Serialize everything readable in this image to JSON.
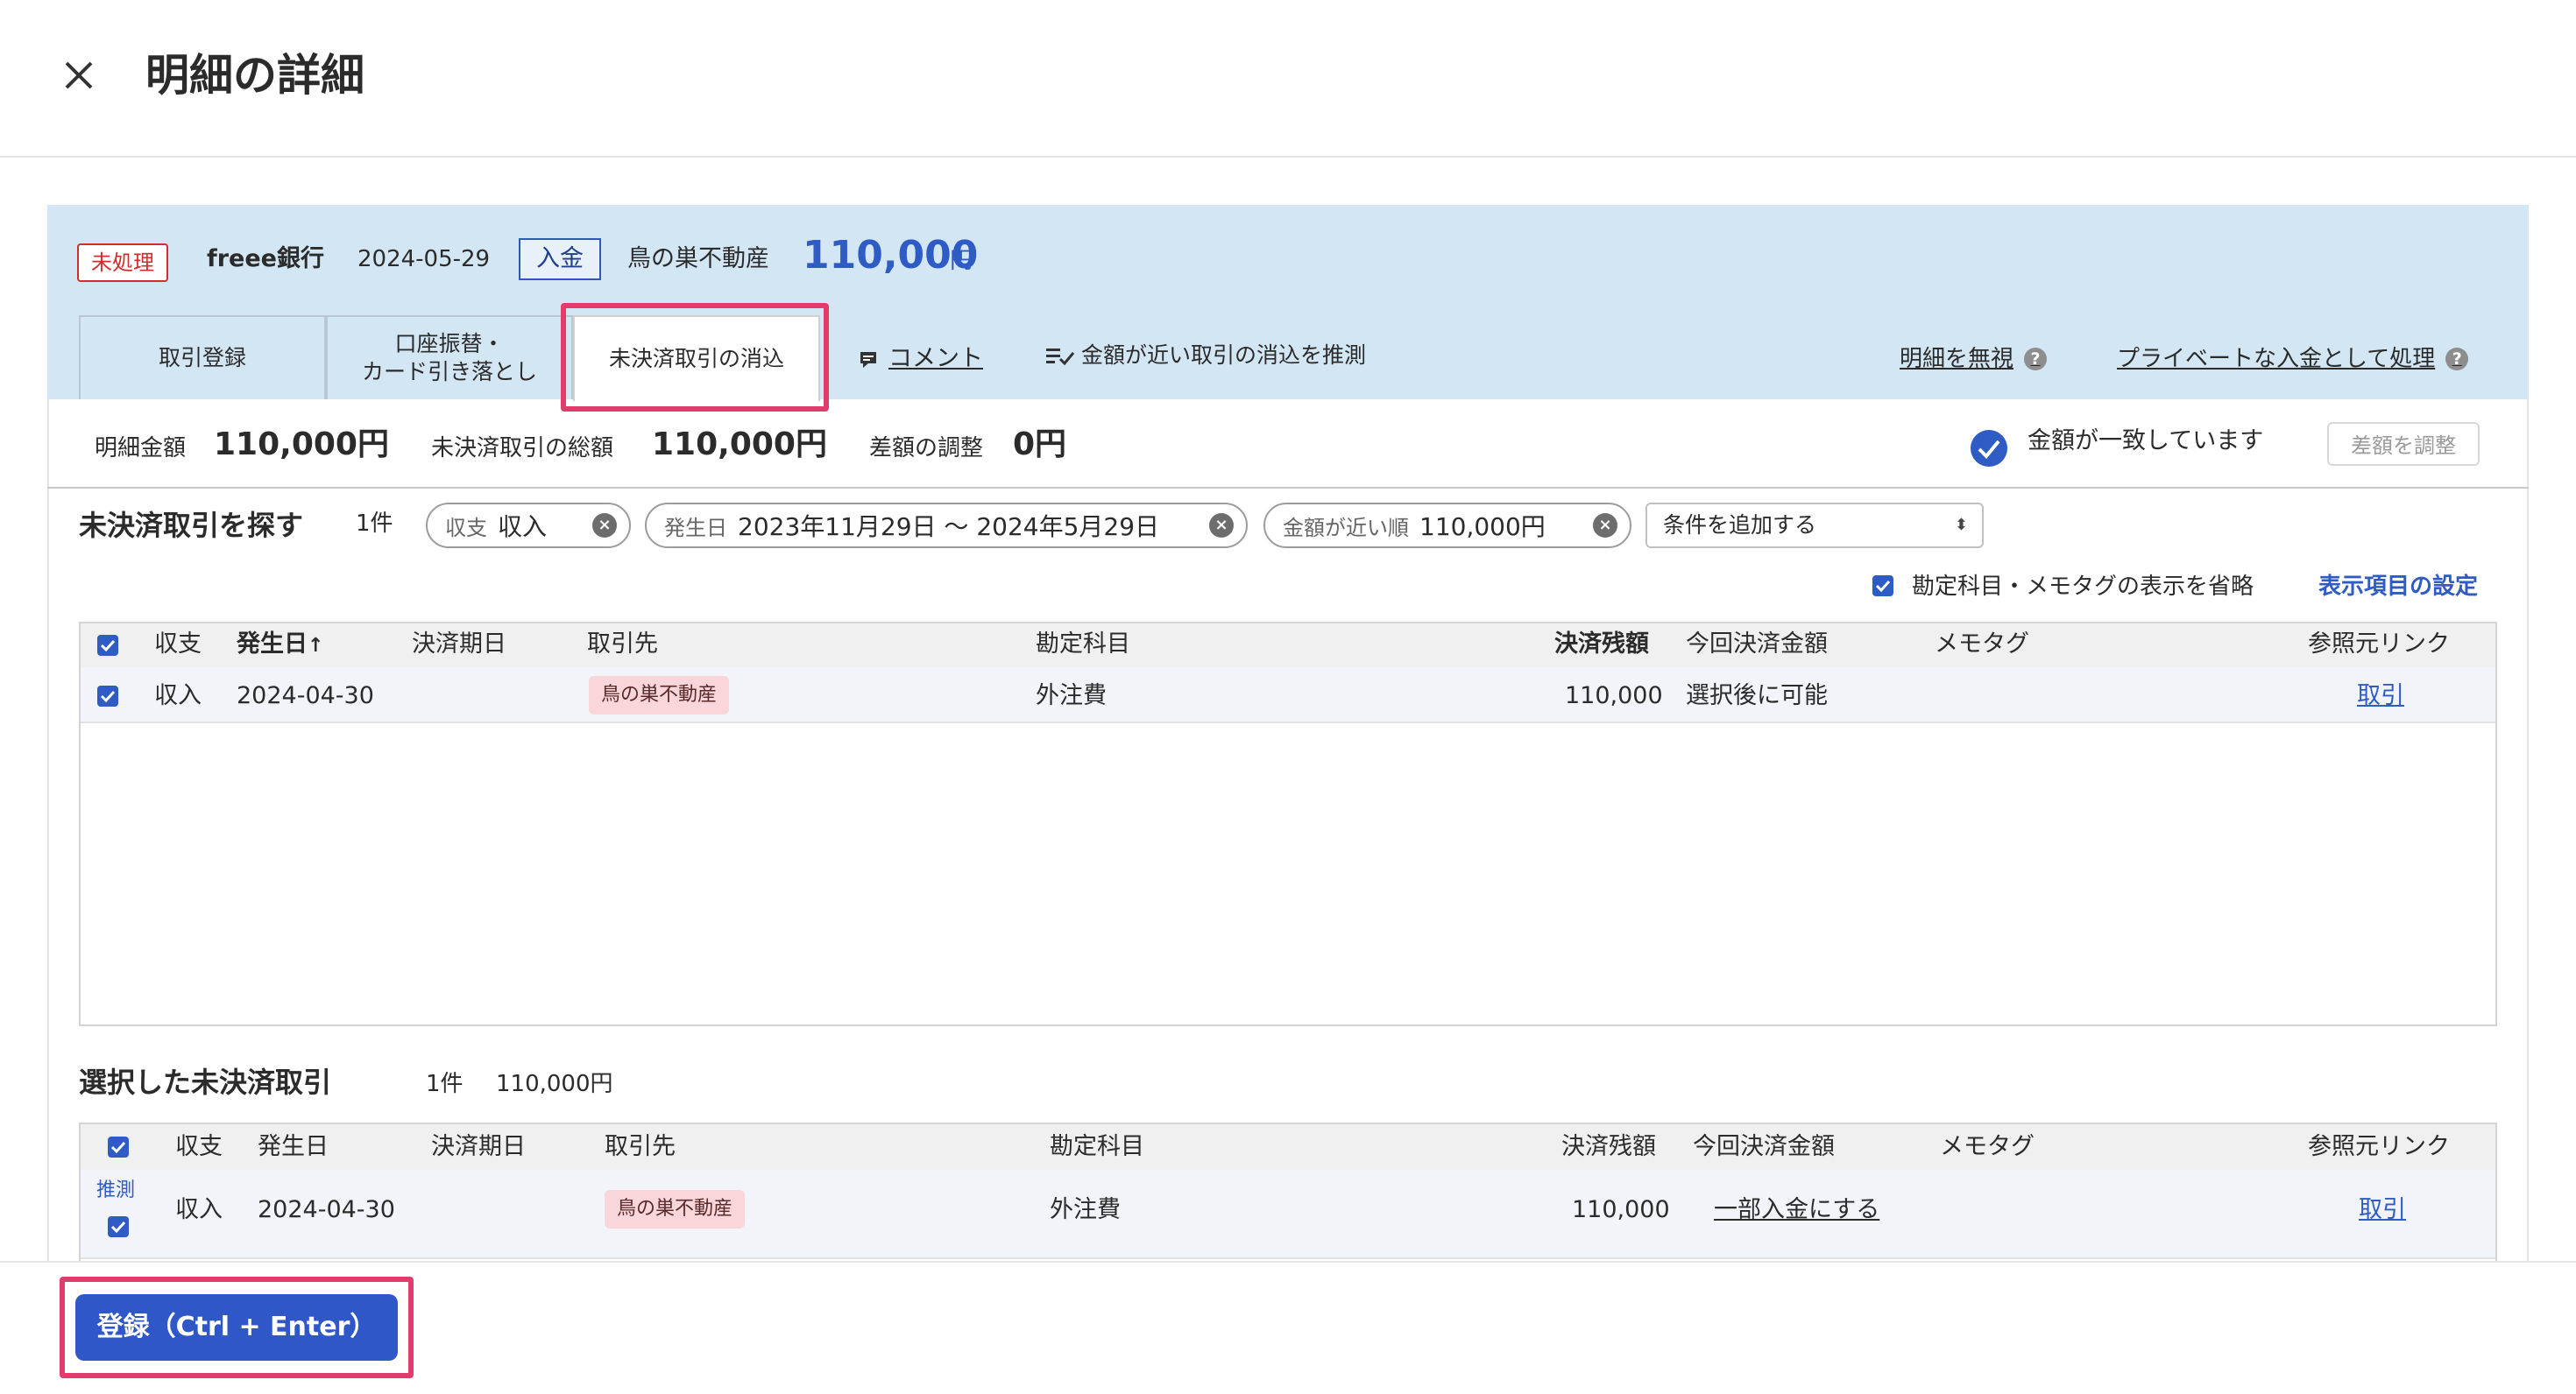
{
  "header": {
    "title": "明細の詳細"
  },
  "statement": {
    "status_badge": "未処理",
    "bank": "freee銀行",
    "date": "2024-05-29",
    "type": "入金",
    "partner": "鳥の巣不動産",
    "amount": "110,000",
    "amount_unit": "円"
  },
  "tabs": [
    {
      "label_line1": "取引登録",
      "label_line2": ""
    },
    {
      "label_line1": "口座振替・",
      "label_line2": "カード引き落とし"
    },
    {
      "label_line1": "未決済取引の消込",
      "label_line2": ""
    }
  ],
  "actions": {
    "comment": "コメント",
    "suggest": "金額が近い取引の消込を推測",
    "ignore": "明細を無視",
    "private": "プライベートな入金として処理",
    "help_glyph": "?"
  },
  "summary": {
    "statement_amount_label": "明細金額",
    "statement_amount": "110,000円",
    "unsettled_total_label": "未決済取引の総額",
    "unsettled_total": "110,000円",
    "diff_label": "差額の調整",
    "diff": "0円",
    "match_text": "金額が一致しています",
    "adjust_button": "差額を調整"
  },
  "search": {
    "title": "未決済取引を探す",
    "count": "1件",
    "chips": [
      {
        "key": "収支",
        "value": "収入"
      },
      {
        "key": "発生日",
        "value": "2023年11月29日 〜 2024年5月29日"
      },
      {
        "key": "金額が近い順",
        "value": "110,000円"
      }
    ],
    "add_condition": "条件を追加する",
    "omit_label": "勘定科目・メモタグの表示を省略",
    "settings_link": "表示項目の設定"
  },
  "search_table": {
    "headers": {
      "type": "収支",
      "date": "発生日",
      "sort_arrow": "↑",
      "due": "決済期日",
      "partner": "取引先",
      "account": "勘定科目",
      "balance": "決済残額",
      "amount": "今回決済金額",
      "memo": "メモタグ",
      "link": "参照元リンク"
    },
    "rows": [
      {
        "type": "収入",
        "date": "2024-04-30",
        "partner": "鳥の巣不動産",
        "account": "外注費",
        "balance": "110,000",
        "amount": "選択後に可能",
        "link": "取引"
      }
    ]
  },
  "selected": {
    "title": "選択した未決済取引",
    "count": "1件",
    "total": "110,000円",
    "headers": {
      "type": "収支",
      "date": "発生日",
      "due": "決済期日",
      "partner": "取引先",
      "account": "勘定科目",
      "balance": "決済残額",
      "amount": "今回決済金額",
      "memo": "メモタグ",
      "link": "参照元リンク"
    },
    "rows": [
      {
        "guess": "推測",
        "type": "収入",
        "date": "2024-04-30",
        "partner": "鳥の巣不動産",
        "account": "外注費",
        "balance": "110,000",
        "amount": "一部入金にする",
        "link": "取引"
      }
    ]
  },
  "footer": {
    "submit": "登録（Ctrl + Enter）"
  },
  "colors": {
    "accent": "#3057c7",
    "panel": "#d3e6f4",
    "highlight": "#e23c6c",
    "badge": "#d12d2d"
  }
}
